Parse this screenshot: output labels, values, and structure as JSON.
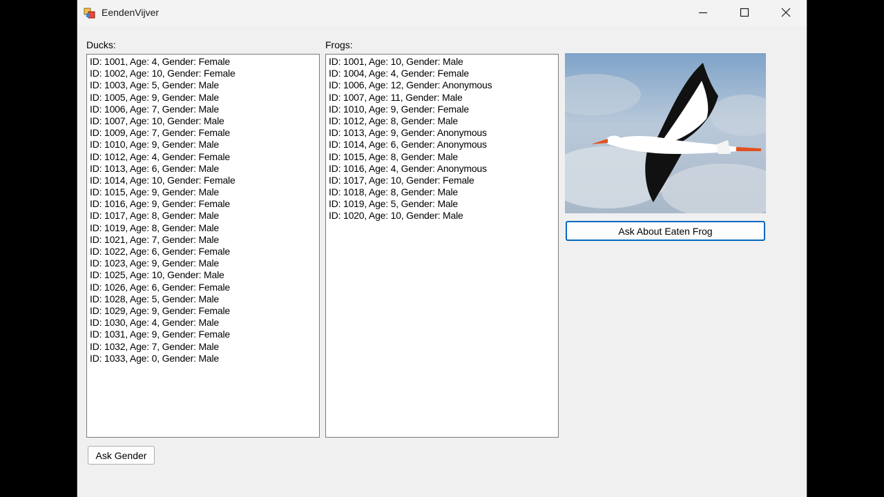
{
  "window": {
    "title": "EendenVijver"
  },
  "ducks": {
    "label": "Ducks:",
    "items": [
      "ID: 1001, Age: 4, Gender: Female",
      "ID: 1002, Age: 10, Gender: Female",
      "ID: 1003, Age: 5, Gender: Male",
      "ID: 1005, Age: 9, Gender: Male",
      "ID: 1006, Age: 7, Gender: Male",
      "ID: 1007, Age: 10, Gender: Male",
      "ID: 1009, Age: 7, Gender: Female",
      "ID: 1010, Age: 9, Gender: Male",
      "ID: 1012, Age: 4, Gender: Female",
      "ID: 1013, Age: 6, Gender: Male",
      "ID: 1014, Age: 10, Gender: Female",
      "ID: 1015, Age: 9, Gender: Male",
      "ID: 1016, Age: 9, Gender: Female",
      "ID: 1017, Age: 8, Gender: Male",
      "ID: 1019, Age: 8, Gender: Male",
      "ID: 1021, Age: 7, Gender: Male",
      "ID: 1022, Age: 6, Gender: Female",
      "ID: 1023, Age: 9, Gender: Male",
      "ID: 1025, Age: 10, Gender: Male",
      "ID: 1026, Age: 6, Gender: Female",
      "ID: 1028, Age: 5, Gender: Male",
      "ID: 1029, Age: 9, Gender: Female",
      "ID: 1030, Age: 4, Gender: Male",
      "ID: 1031, Age: 9, Gender: Female",
      "ID: 1032, Age: 7, Gender: Male",
      "ID: 1033, Age: 0, Gender: Male"
    ]
  },
  "frogs": {
    "label": "Frogs:",
    "items": [
      "ID: 1001, Age: 10, Gender: Male",
      "ID: 1004, Age: 4, Gender: Female",
      "ID: 1006, Age: 12, Gender: Anonymous",
      "ID: 1007, Age: 11, Gender: Male",
      "ID: 1010, Age: 9, Gender: Female",
      "ID: 1012, Age: 8, Gender: Male",
      "ID: 1013, Age: 9, Gender: Anonymous",
      "ID: 1014, Age: 6, Gender: Anonymous",
      "ID: 1015, Age: 8, Gender: Male",
      "ID: 1016, Age: 4, Gender: Anonymous",
      "ID: 1017, Age: 10, Gender: Female",
      "ID: 1018, Age: 8, Gender: Male",
      "ID: 1019, Age: 5, Gender: Male",
      "ID: 1020, Age: 10, Gender: Male"
    ]
  },
  "buttons": {
    "ask_eaten_frog": "Ask About Eaten Frog",
    "ask_gender": "Ask Gender"
  },
  "icons": {
    "app": "app-form-icon",
    "minimize": "minimize-icon",
    "maximize": "maximize-icon",
    "close": "close-icon",
    "picture": "stork-image"
  },
  "colors": {
    "focus_border": "#0067c0",
    "window_bg": "#f0f0f0"
  }
}
